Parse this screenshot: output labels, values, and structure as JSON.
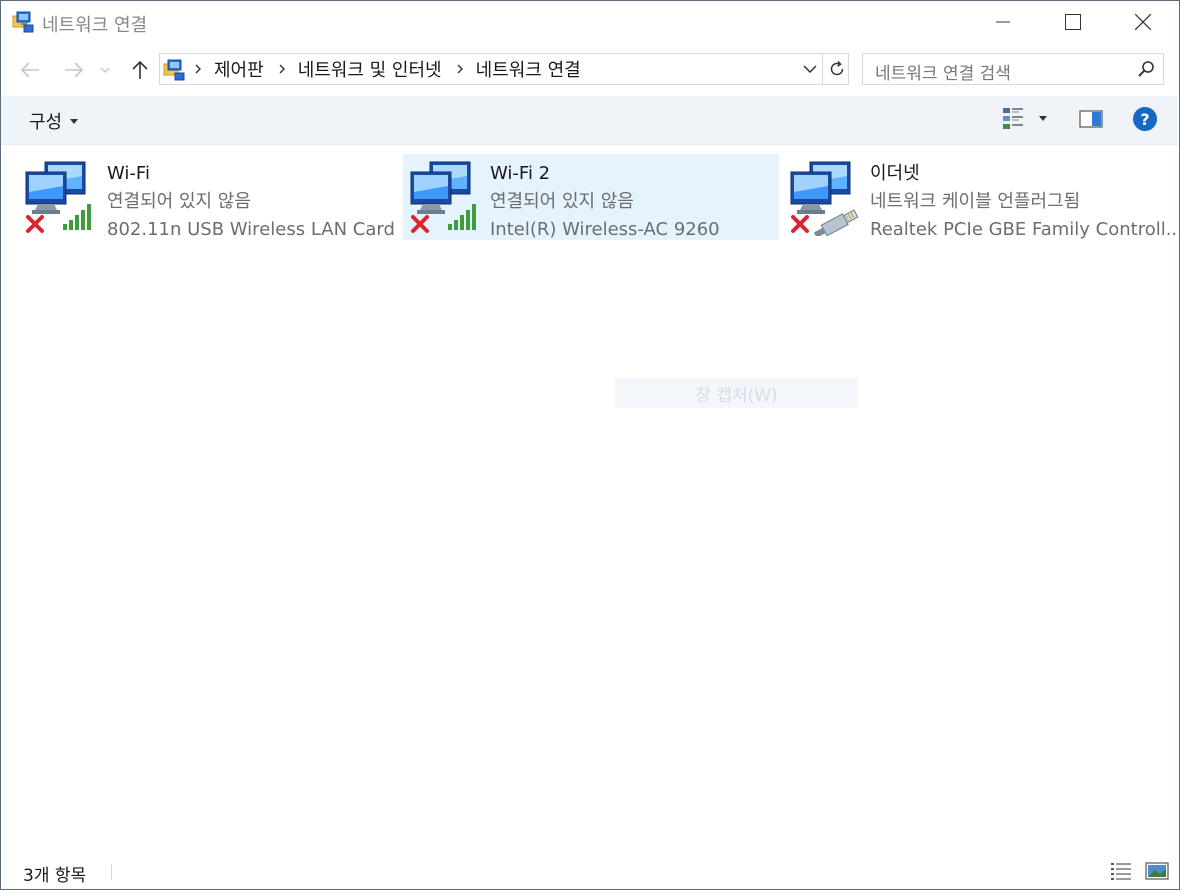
{
  "window": {
    "title": "네트워크 연결"
  },
  "address": {
    "crumbs": [
      "제어판",
      "네트워크 및 인터넷",
      "네트워크 연결"
    ]
  },
  "search": {
    "placeholder": "네트워크 연결 검색"
  },
  "toolbar": {
    "organize_label": "구성",
    "help_label": "?"
  },
  "items": [
    {
      "name": "Wi-Fi",
      "status": "연결되어 있지 않음",
      "device": "802.11n USB Wireless LAN Card",
      "type": "wireless",
      "selected": false
    },
    {
      "name": "Wi-Fi 2",
      "status": "연결되어 있지 않음",
      "device": "Intel(R) Wireless-AC 9260",
      "type": "wireless",
      "selected": true
    },
    {
      "name": "이더넷",
      "status": "네트워크 케이블 언플러그됨",
      "device": "Realtek PCIe GBE Family Controll...",
      "type": "ethernet",
      "selected": false
    }
  ],
  "overlay": {
    "text": "창 캡처(W)"
  },
  "statusbar": {
    "count": "3개 항목"
  },
  "colors": {
    "selection": "#e5f3ff",
    "command_bar": "#f0f4f9",
    "help_blue": "#1768c2",
    "error_red": "#d9262c",
    "signal_green": "#3e9b3e"
  },
  "icons": {
    "title": "network-folder-icon",
    "wireless": "wireless-adapter-icon",
    "ethernet": "ethernet-adapter-icon",
    "disconnected": "red-x-icon"
  }
}
